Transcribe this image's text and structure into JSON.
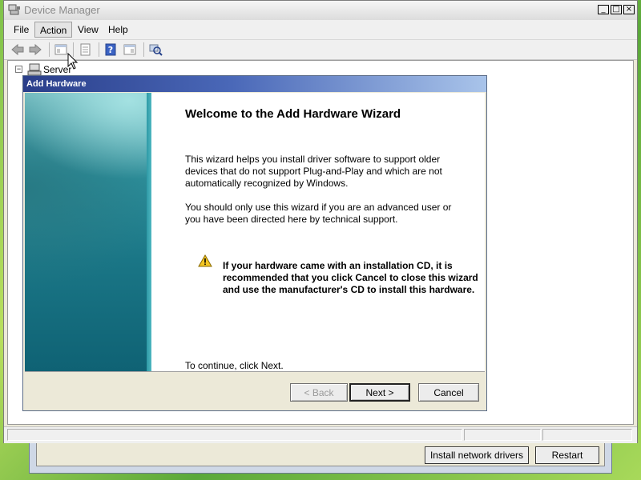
{
  "background_window": {
    "buttons": [
      "Install network drivers",
      "Restart"
    ]
  },
  "window": {
    "title": "Device Manager",
    "controls": [
      "minimize",
      "maximize",
      "close"
    ]
  },
  "menu": {
    "items": [
      "File",
      "Action",
      "View",
      "Help"
    ],
    "active": "Action"
  },
  "toolbar": {
    "icons": [
      "back-icon",
      "forward-icon",
      "console-tree-icon",
      "properties-icon",
      "help-icon",
      "action-pane-icon",
      "scan-hardware-icon"
    ]
  },
  "tree": {
    "root_label": "Server",
    "expander": "−"
  },
  "wizard": {
    "title": "Add Hardware",
    "heading": "Welcome to the Add Hardware Wizard",
    "paragraph1": "This wizard helps you install driver software to support older devices that do not support Plug-and-Play and which are not automatically recognized by Windows.",
    "paragraph2": "You should only use this wizard if you are an advanced user or you have been directed here by technical support.",
    "warning": "If your hardware came with an installation CD, it is recommended that you click Cancel to close this wizard and use the manufacturer's CD to install this hardware.",
    "continue": "To continue, click Next.",
    "buttons": {
      "back": "< Back",
      "next": "Next >",
      "cancel": "Cancel"
    }
  },
  "colors": {
    "wizard_title_start": "#2a3e8a",
    "wizard_title_end": "#a9c4ea",
    "side_panel": "#1a7686",
    "desktop": "#7fc24a"
  }
}
